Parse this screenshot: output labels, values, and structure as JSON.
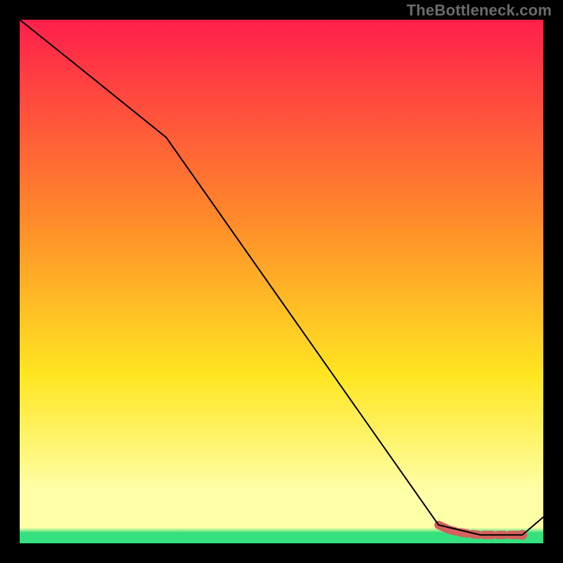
{
  "watermark": "TheBottleneck.com",
  "chart_data": {
    "type": "line",
    "title": "",
    "xlabel": "",
    "ylabel": "",
    "xlim": [
      0,
      100
    ],
    "ylim": [
      0,
      100
    ],
    "grid": false,
    "legend": null,
    "gradient": {
      "top": "#ff1f4b",
      "mid_high": "#ff8a2a",
      "mid": "#ffe621",
      "low": "#ffffa8",
      "base_band": "#35e07e"
    },
    "series": [
      {
        "name": "curve",
        "color": "#000000",
        "x": [
          0,
          10,
          28,
          80,
          88,
          96,
          100
        ],
        "y": [
          100,
          92,
          77.5,
          3.5,
          1.6,
          1.6,
          5
        ]
      }
    ],
    "markers": {
      "name": "highlight-segment",
      "color": "#d4615d",
      "points": [
        {
          "x": 80,
          "y": 3.5
        },
        {
          "x": 82,
          "y": 2.6
        },
        {
          "x": 83.5,
          "y": 2.2
        },
        {
          "x": 86,
          "y": 1.8
        },
        {
          "x": 88,
          "y": 1.6
        },
        {
          "x": 91,
          "y": 1.6
        },
        {
          "x": 93,
          "y": 1.6
        },
        {
          "x": 96,
          "y": 1.6
        }
      ],
      "end_dot": {
        "x": 96,
        "y": 1.6
      }
    }
  }
}
